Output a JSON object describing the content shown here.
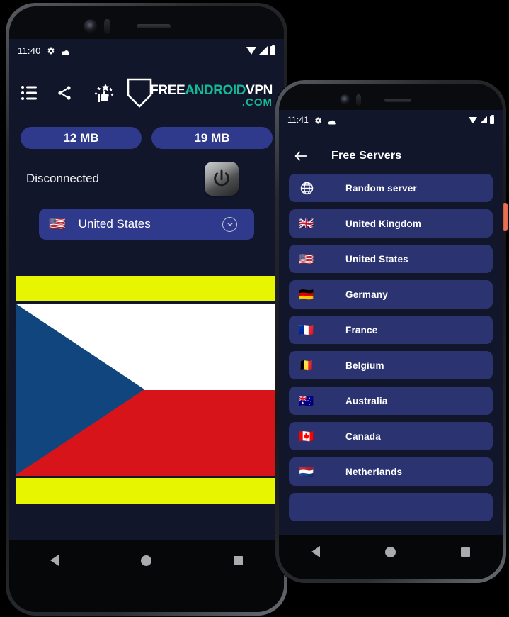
{
  "phone1": {
    "status_bar": {
      "time": "11:40",
      "icons_left": [
        "gear-icon",
        "cloud-icon"
      ],
      "icons_right": [
        "wifi-icon",
        "signal-icon",
        "battery-icon"
      ]
    },
    "header": {
      "icons": [
        "list-menu-icon",
        "share-icon",
        "rate-thumbs-up-icon"
      ],
      "logo": {
        "part1": "FREE",
        "part2": "ANDROID",
        "part3": "VPN",
        "part4": ".COM",
        "white": "#ffffff",
        "teal": "#14b89a"
      }
    },
    "badges": [
      {
        "label": "12 MB"
      },
      {
        "label": "19 MB"
      }
    ],
    "status": {
      "text": "Disconnected"
    },
    "power_button": {
      "label": "power-toggle"
    },
    "country_selector": {
      "flag": "🇺🇸",
      "name": "United States",
      "chevron": "chevron-down-icon"
    },
    "ad_banner_color": "#e8f500",
    "flag_image": {
      "name": "czech-republic-flag",
      "white": "#ffffff",
      "red": "#d7141a",
      "blue": "#11457e"
    },
    "nav_bar": [
      "back-icon",
      "home-icon",
      "recents-icon"
    ]
  },
  "phone2": {
    "status_bar": {
      "time": "11:41",
      "icons_left": [
        "gear-icon",
        "cloud-icon"
      ],
      "icons_right": [
        "wifi-icon",
        "signal-icon",
        "battery-icon"
      ]
    },
    "header": {
      "back": "back-arrow-icon",
      "title": "Free Servers"
    },
    "servers": [
      {
        "flag": "globe",
        "label": "Random server"
      },
      {
        "flag": "🇬🇧",
        "label": "United Kingdom"
      },
      {
        "flag": "🇺🇸",
        "label": "United States"
      },
      {
        "flag": "🇩🇪",
        "label": "Germany"
      },
      {
        "flag": "🇫🇷",
        "label": "France"
      },
      {
        "flag": "🇧🇪",
        "label": "Belgium"
      },
      {
        "flag": "🇦🇺",
        "label": "Australia"
      },
      {
        "flag": "🇨🇦",
        "label": "Canada"
      },
      {
        "flag": "🇳🇱",
        "label": "Netherlands"
      },
      {
        "flag": "",
        "label": ""
      }
    ],
    "side_button_color": "#ef7a5d",
    "nav_bar": [
      "back-icon",
      "home-icon",
      "recents-icon"
    ]
  },
  "theme": {
    "screen_bg": "#12162b",
    "accent_blue": "#2f3a8c",
    "list_item_bg": "#2b3470"
  }
}
